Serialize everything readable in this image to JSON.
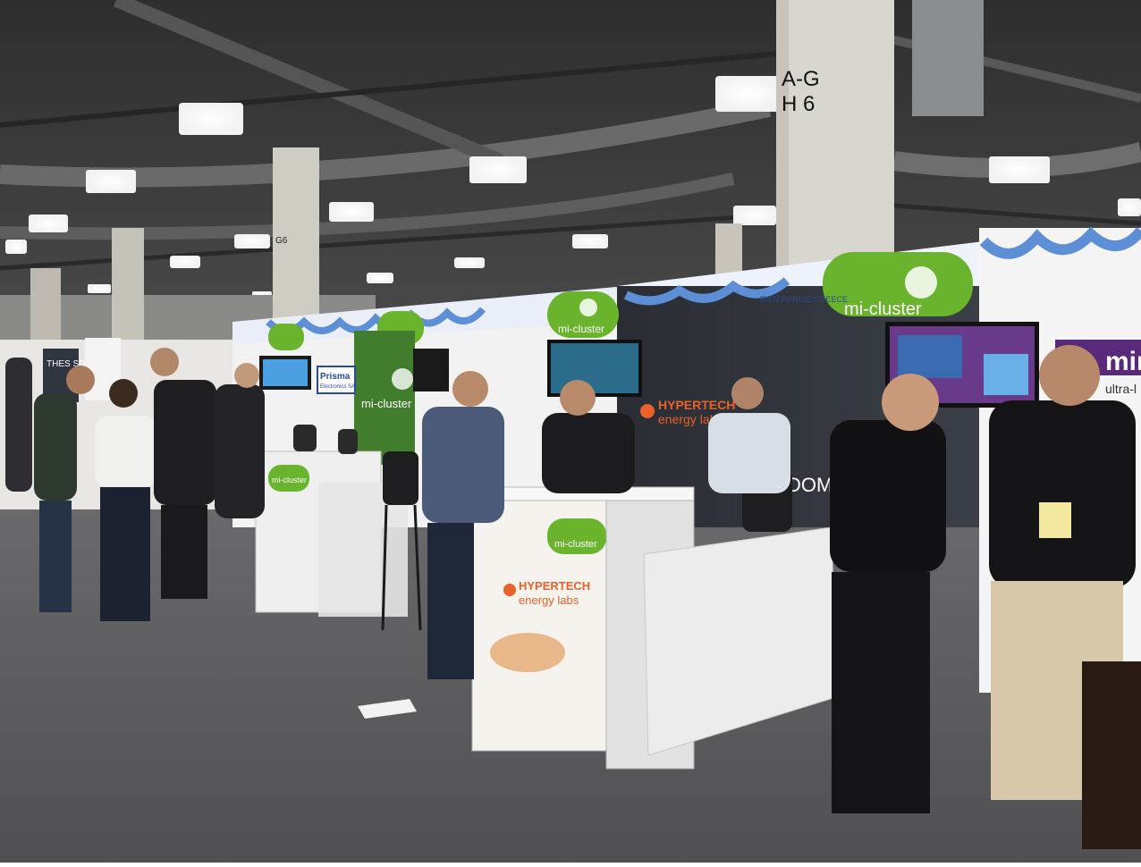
{
  "pillar_sign": {
    "line1": "A-G",
    "line2": "H 6"
  },
  "small_pillar_sign": "G6",
  "banners": {
    "mi_cluster_large": "mi-cluster",
    "mi_cluster_mid": "mi-cluster",
    "mi_cluster_small": "mi-cluster",
    "enterprise_greece": "ENTERPRISE GREECE",
    "hypertech_line1": "HYPERTECH",
    "hypertech_line2": "energy labs",
    "dome_text": "DOME",
    "right_booth_text": "mir",
    "right_booth_sub": "ultra-l",
    "far_left_sign": "THES SDO",
    "prisma_sign": "Prisma",
    "prisma_sub": "Electronics SA"
  },
  "counter_left": {
    "brand": "mi-cluster"
  },
  "counter_center": {
    "brand": "mi-cluster",
    "hypertech_line1": "HYPERTECH",
    "hypertech_line2": "energy labs"
  },
  "standing_banner": {
    "brand": "mi-cluster"
  },
  "colors": {
    "brand_green": "#6ab42d",
    "ceiling": "#3a3a3a",
    "carpet": "#5d5d5f",
    "booth_wall": "#f2f2f2",
    "dark_panel": "#2a2d33",
    "hypertech_orange": "#e8622a"
  }
}
